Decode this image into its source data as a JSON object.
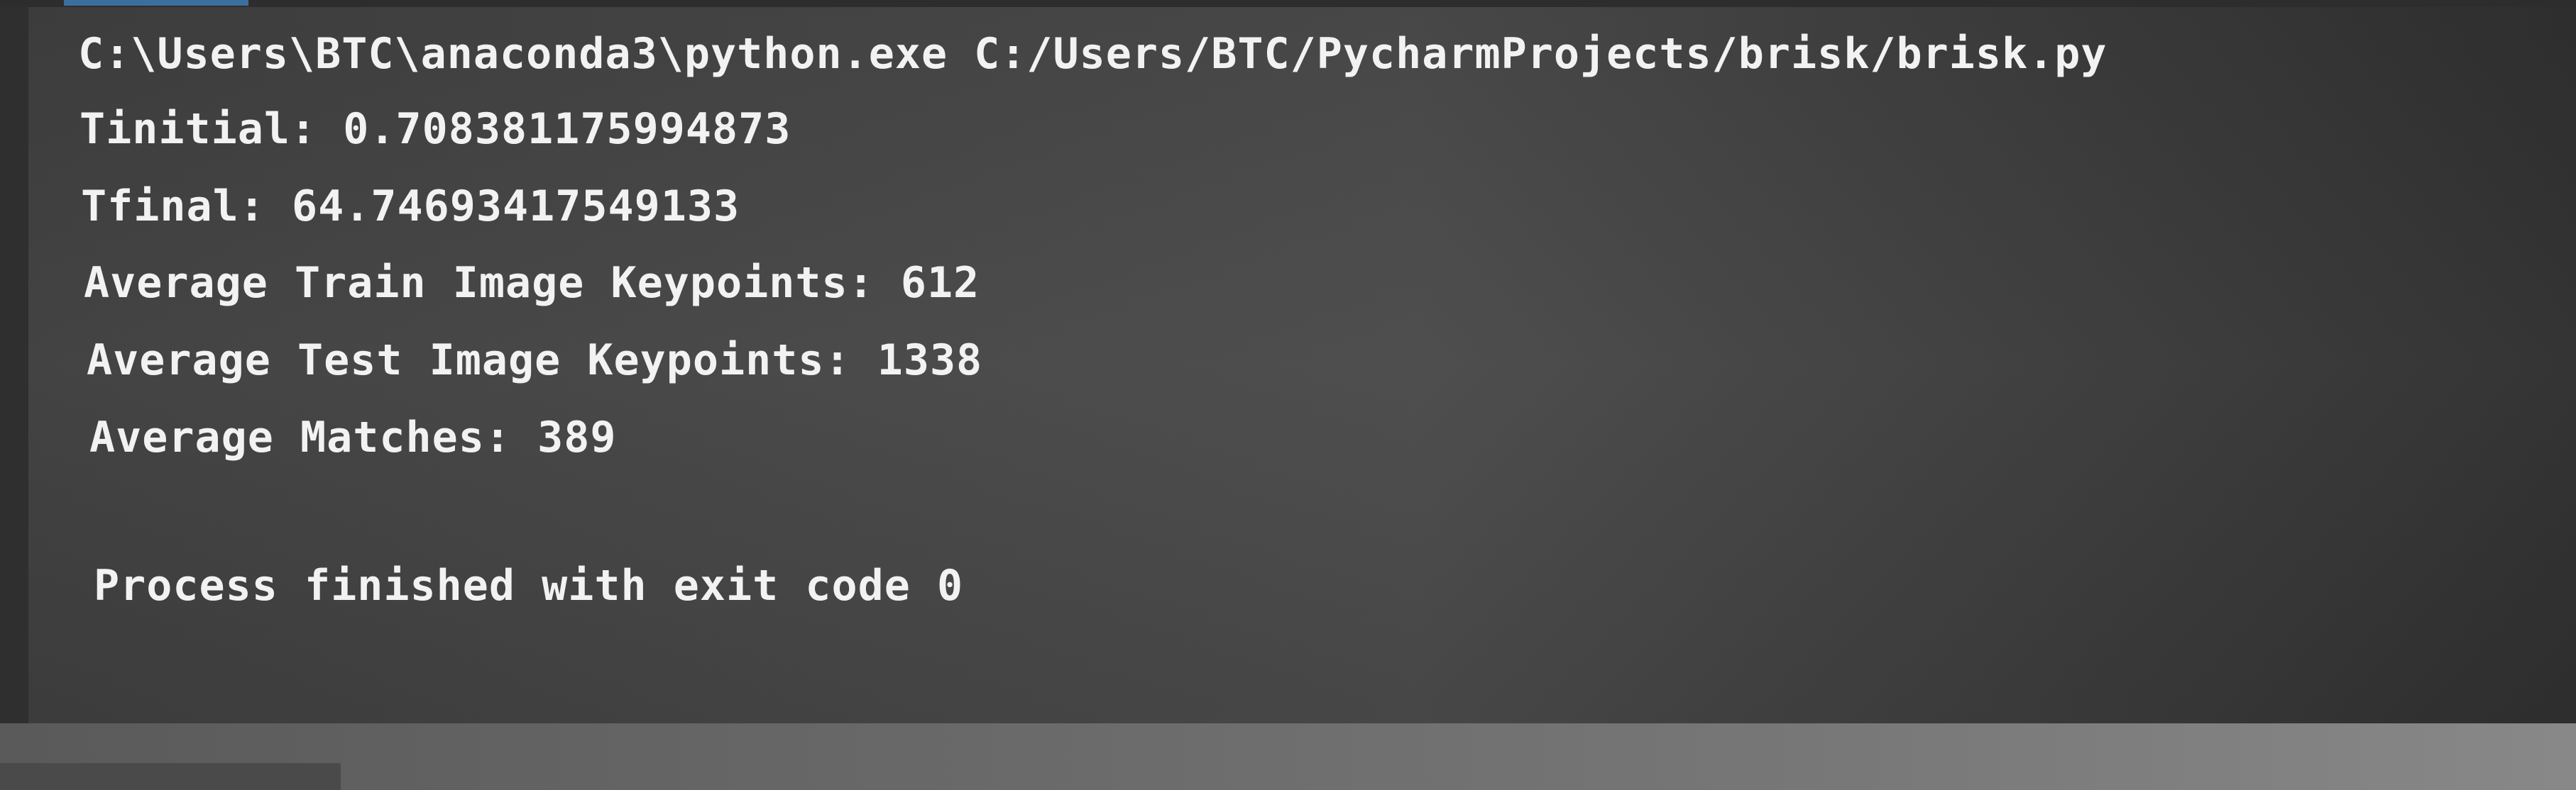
{
  "console": {
    "command": "C:\\Users\\BTC\\anaconda3\\python.exe C:/Users/BTC/PycharmProjects/brisk/brisk.py",
    "lines": [
      "Tinitial: 0.70838117599487З",
      "Tfinal: 64.74693417549133",
      "Average Train Image Keypoints: 612",
      "Average Test Image Keypoints: 1338",
      "Average Matches: 389"
    ],
    "exit_message": "Process finished with exit code 0"
  },
  "colors": {
    "background": "#444444",
    "text": "#f2f2f2",
    "accent": "#3b6f9e"
  }
}
